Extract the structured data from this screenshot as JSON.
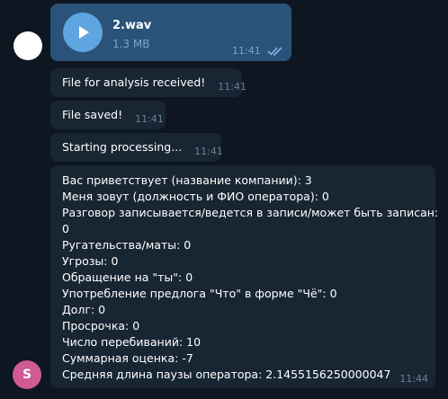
{
  "avatars": {
    "bottom_initial": "S"
  },
  "messages": {
    "audio": {
      "file_name": "2.wav",
      "file_size": "1.3 MB",
      "time": "11:41",
      "icon": "play-icon",
      "status_icon": "double-check-icon"
    },
    "msg1": {
      "text": "File for analysis received!",
      "time": "11:41"
    },
    "msg2": {
      "text": "File saved!",
      "time": "11:41"
    },
    "msg3": {
      "text": "Starting processing...",
      "time": "11:41"
    },
    "report": {
      "lines": [
        "Вас приветствует (название компании):  3",
        "Меня зовут (должность и ФИО оператора):  0",
        "Разговор записывается/ведется в записи/может быть записан:",
        "0",
        "Ругательства/маты:  0",
        "Угрозы:  0",
        "Обращение на \"ты\":  0",
        "Употребление предлога \"Что\" в форме \"Чё\":  0",
        "Долг:  0",
        "Просрочка:  0",
        "Число перебиваний:  10",
        "Суммарная оценка:  -7",
        "Средняя длина паузы оператора:  2.1455156250000047"
      ],
      "time": "11:44"
    }
  },
  "colors": {
    "background": "#0e1621",
    "bubble_in": "#182533",
    "bubble_out": "#2b5278",
    "accent": "#5fa6e0",
    "avatar_s": "#d05a93"
  }
}
